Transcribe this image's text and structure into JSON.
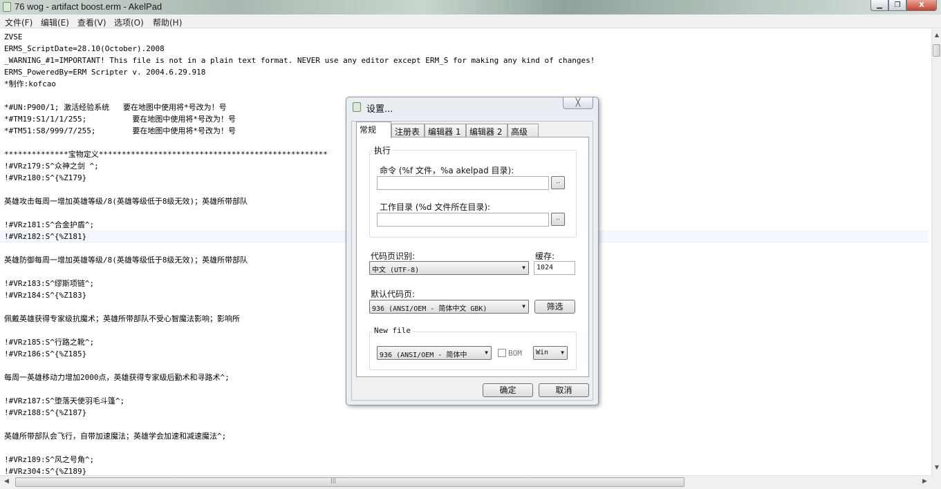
{
  "window": {
    "title": "76 wog - artifact boost.erm - AkelPad",
    "min": "▁",
    "max": "❐",
    "close": "X"
  },
  "menu": [
    "文件(F)",
    "编辑(E)",
    "查看(V)",
    "选项(O)",
    "帮助(H)"
  ],
  "editor": {
    "lines": [
      "ZVSE",
      "ERMS_ScriptDate=28.10(October).2008",
      "_WARNING_#1=IMPORTANT! This file is not in a plain text format. NEVER use any editor except ERM_S for making any kind of changes!",
      "ERMS_PoweredBy=ERM Scripter v. 2004.6.29.918",
      "*制作:kofcao",
      "",
      "*#UN:P900/1; 激活经验系统   要在地图中使用将*号改为！号",
      "*#TM19:S1/1/1/255;          要在地图中使用将*号改为！号",
      "*#TM51:S8/999/7/255;        要在地图中使用将*号改为！号",
      "",
      "**************宝物定义**************************************************",
      "!#VRz179:S^众神之剑 ^;",
      "!#VRz180:S^{%Z179}",
      "",
      "英雄攻击每周一增加英雄等级/8(英雄等级低于8级无效)；英雄所带部队",
      "",
      "!#VRz181:S^合金护盾^;",
      "!#VRz182:S^{%Z181}",
      "",
      "英雄防御每周一增加英雄等级/8(英雄等级低于8级无效)；英雄所带部队",
      "",
      "!#VRz183:S^缪斯项链^;",
      "!#VRz184:S^{%Z183}",
      "",
      "佩戴英雄获得专家级抗魔术；英雄所带部队不受心智魔法影响；影响所",
      "",
      "!#VRz185:S^行路之靴^;",
      "!#VRz186:S^{%Z185}",
      "",
      "每周一英雄移动力增加2000点，英雄获得专家级后勤术和寻路术^;",
      "",
      "!#VRz187:S^堕落天使羽毛斗篷^;",
      "!#VRz188:S^{%Z187}",
      "",
      "英雄所带部队会飞行，自带加速魔法；英雄学会加速和减速魔法^;",
      "",
      "!#VRz189:S^风之号角^;",
      "!#VRz304:S^{%Z189}"
    ]
  },
  "dialog": {
    "title": "设置...",
    "close": "╳",
    "tabs": [
      "常规",
      "注册表",
      "编辑器 1",
      "编辑器 2",
      "高级"
    ],
    "exec_group": "执行",
    "command_label": "命令 (%f 文件，%a akelpad 目录):",
    "command_value": "",
    "workdir_label": "工作目录 (%d 文件所在目录):",
    "workdir_value": "",
    "browse": "..",
    "codepage_detect_label": "代码页识别:",
    "codepage_detect_value": "中文 (UTF-8)",
    "buffer_label": "缓存:",
    "buffer_value": "1024",
    "default_codepage_label": "默认代码页:",
    "default_codepage_value": "936  (ANSI/OEM - 简体中文 GBK)",
    "filter_button": "筛选",
    "newfile_group": "New file",
    "newfile_codepage": "936  (ANSI/OEM - 简体中",
    "bom_label": "BOM",
    "bom_checked": false,
    "newline_value": "Win",
    "ok": "确定",
    "cancel": "取消"
  },
  "scroll": {
    "up": "▲",
    "down": "▼",
    "left": "◀",
    "right": "▶",
    "grip": "|||"
  }
}
